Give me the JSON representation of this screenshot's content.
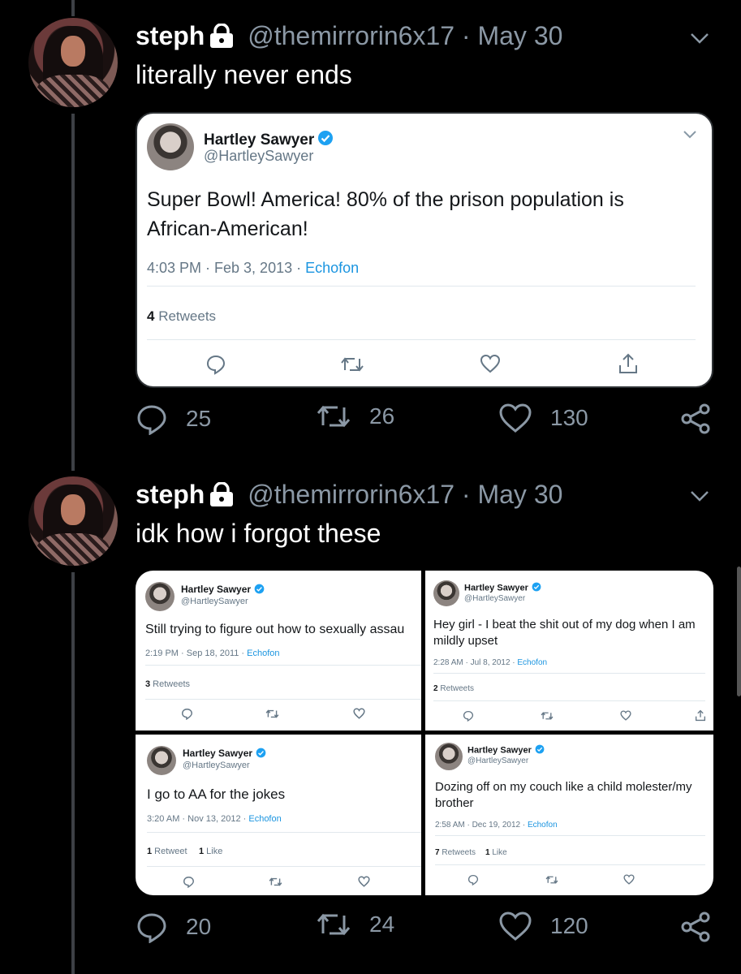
{
  "tweets": [
    {
      "author_name": "steph",
      "handle": "@themirrorin6x17",
      "separator": "·",
      "date": "May 30",
      "text": "literally never ends",
      "stats": {
        "replies": "25",
        "retweets": "26",
        "likes": "130"
      },
      "embed": {
        "name": "Hartley Sawyer",
        "handle": "@HartleySawyer",
        "text_line1": "Super Bowl! America! 80% of the prison population is",
        "text_line2": "African-American!",
        "time": "4:03 PM · Feb 3, 2013 · ",
        "source": "Echofon",
        "retweet_count": "4",
        "retweet_label": " Retweets"
      }
    },
    {
      "author_name": "steph",
      "handle": "@themirrorin6x17",
      "separator": "·",
      "date": "May 30",
      "text": "idk how i forgot these",
      "stats": {
        "replies": "20",
        "retweets": "24",
        "likes": "120"
      },
      "embeds": [
        {
          "name": "Hartley Sawyer",
          "handle": "@HartleySawyer",
          "text_line1": "Still trying to figure out how to sexually assau",
          "text_line2": "",
          "time": "2:19 PM · Sep 18, 2011 · ",
          "source": "Echofon",
          "retweet_count": "3",
          "retweet_label": " Retweets",
          "like_count": "",
          "like_label": ""
        },
        {
          "name": "Hartley Sawyer",
          "handle": "@HartleySawyer",
          "text_line1": "Hey girl - I beat the shit out of my dog when I am",
          "text_line2": "mildly upset",
          "time": "2:28 AM · Jul 8, 2012 · ",
          "source": "Echofon",
          "retweet_count": "2",
          "retweet_label": " Retweets",
          "like_count": "",
          "like_label": ""
        },
        {
          "name": "Hartley Sawyer",
          "handle": "@HartleySawyer",
          "text_line1": "I go to AA for the jokes",
          "text_line2": "",
          "time": "3:20 AM · Nov 13, 2012 · ",
          "source": "Echofon",
          "retweet_count": "1",
          "retweet_label": " Retweet",
          "like_count": "1",
          "like_label": " Like"
        },
        {
          "name": "Hartley Sawyer",
          "handle": "@HartleySawyer",
          "text_line1": "Dozing off on my couch like a child molester/my",
          "text_line2": "brother",
          "time": "2:58 AM · Dec 19, 2012 · ",
          "source": "Echofon",
          "retweet_count": "7",
          "retweet_label": " Retweets",
          "like_count": "1",
          "like_label": " Like"
        }
      ]
    }
  ],
  "icons": [
    "lock-icon",
    "chevron-down-icon",
    "verified-icon",
    "reply-icon",
    "retweet-icon",
    "like-icon",
    "share-icon"
  ],
  "colors": {
    "background": "#000000",
    "muted": "#8b98a5",
    "link": "#1b95e0",
    "verified": "#1da1f2"
  }
}
